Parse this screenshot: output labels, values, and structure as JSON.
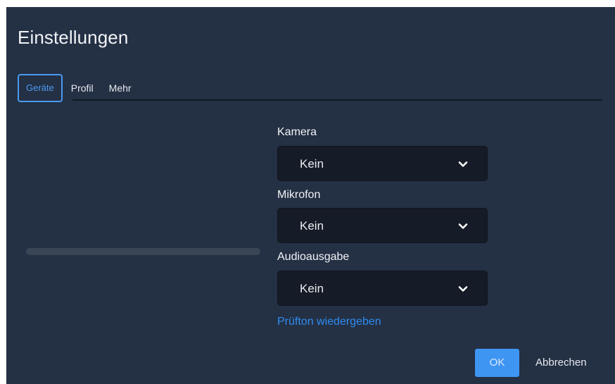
{
  "dialog": {
    "title": "Einstellungen"
  },
  "tabs": [
    {
      "label": "Geräte",
      "active": true
    },
    {
      "label": "Profil",
      "active": false
    },
    {
      "label": "Mehr",
      "active": false
    }
  ],
  "devices": {
    "camera": {
      "label": "Kamera",
      "value": "Kein"
    },
    "microphone": {
      "label": "Mikrofon",
      "value": "Kein"
    },
    "audio_output": {
      "label": "Audioausgabe",
      "value": "Kein"
    },
    "test_tone_link": "Prüfton wiedergeben"
  },
  "footer": {
    "ok_label": "OK",
    "cancel_label": "Abbrechen"
  },
  "colors": {
    "background": "#243044",
    "select_background": "#151b27",
    "accent": "#3e95f2",
    "link": "#2f8cf0"
  },
  "icons": {
    "select_chevron": "chevron-down-icon"
  }
}
